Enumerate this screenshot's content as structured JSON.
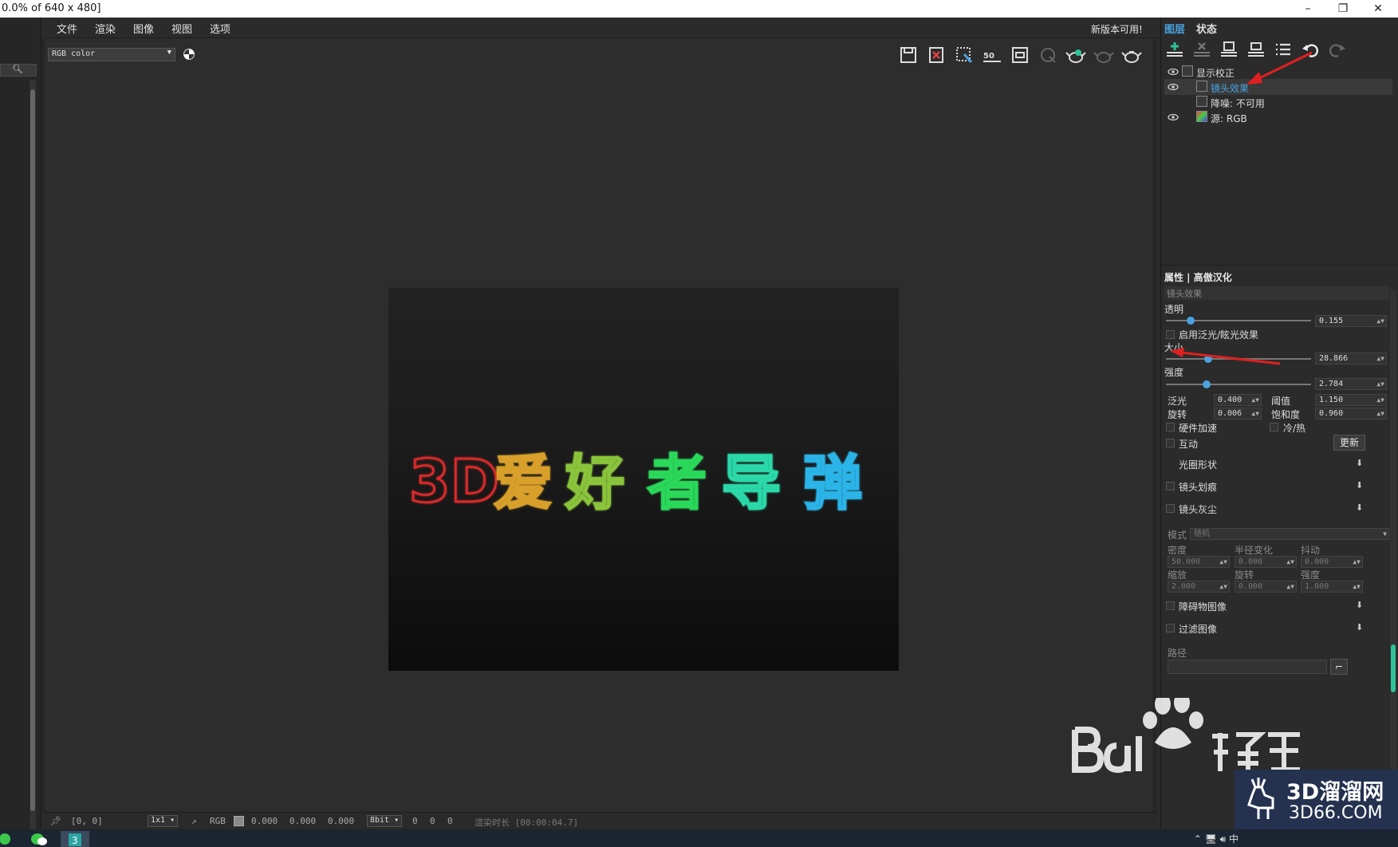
{
  "window": {
    "title": "0.0% of 640 x 480]",
    "minimize_icon": "minimize-icon",
    "restore_icon": "restore-icon",
    "close_icon": "close-icon"
  },
  "menu": {
    "items": [
      "文件",
      "渲染",
      "图像",
      "视图",
      "选项"
    ],
    "update_notice": "新版本可用!"
  },
  "toolbar": {
    "channel_select": "RGB color",
    "tool_icons": [
      "save-icon",
      "clear-icon",
      "region-select-icon",
      "zoom-50-icon",
      "frame-icon",
      "cursor-icon",
      "teapot-render-icon",
      "teapot-region-icon",
      "teapot-icon"
    ],
    "zoom_label": "50"
  },
  "render": {
    "text_chars": [
      "3D",
      "爱",
      "好",
      "者",
      "导",
      "弹"
    ],
    "colors": {
      "red": "#e02a2a",
      "orange": "#d8a02a",
      "yellow_green": "#8ac43a",
      "green": "#2ad85a",
      "teal": "#2ad8a8",
      "blue": "#2ab4e8"
    }
  },
  "status": {
    "coords": "[0, 0]",
    "ratio": "1x1",
    "channel": "RGB",
    "values": [
      "0.000",
      "0.000",
      "0.000"
    ],
    "bit_depth": "8bit",
    "ints": [
      "0",
      "0",
      "0"
    ],
    "render_time": "渲染时长 [00:00:04.7]"
  },
  "layers_panel": {
    "tabs": [
      "图层",
      "状态"
    ],
    "layers": [
      {
        "name": "显示校正",
        "visible": true,
        "selected": false
      },
      {
        "name": "镜头效果",
        "visible": true,
        "selected": true
      },
      {
        "name": "降噪: 不可用",
        "visible": false,
        "selected": false
      },
      {
        "name": "源: RGB",
        "visible": true,
        "selected": false
      }
    ]
  },
  "properties": {
    "header": "属性 | 高傲汉化",
    "section": "镜头效果",
    "opacity_label": "透明",
    "opacity_value": "0.155",
    "opacity_fraction": 0.17,
    "enable_label": "启用泛光/眩光效果",
    "size_label": "大小",
    "size_value": "28.866",
    "size_fraction": 0.29,
    "intensity_label": "强度",
    "intensity_value": "2.784",
    "intensity_fraction": 0.28,
    "bloom_label": "泛光",
    "bloom_value": "0.400",
    "threshold_label": "阈值",
    "threshold_value": "1.150",
    "rotation_label": "旋转",
    "rotation_value": "0.006",
    "saturation_label": "饱和度",
    "saturation_value": "0.960",
    "hw_accel_label": "硬件加速",
    "cold_hot_label": "冷/热",
    "interactive_label": "互动",
    "update_button": "更新",
    "aperture_label": "光圈形状",
    "scratches_label": "镜头划痕",
    "dust_label": "镜头灰尘",
    "mode_label": "模式",
    "mode_value": "随机",
    "density_label": "密度",
    "density_value": "50.000",
    "radius_var_label": "半径变化",
    "radius_var_value": "0.000",
    "jitter_label": "抖动",
    "jitter_value": "0.000",
    "scale_label": "缩放",
    "scale_value": "2.000",
    "rot2_label": "旋转",
    "rot2_value": "0.000",
    "strength_label": "强度",
    "strength_value": "1.000",
    "obstacle_label": "障碍物图像",
    "filter_label": "过滤图像",
    "path_label": "路径"
  },
  "overlay": {
    "brand_cn": "3D溜溜网",
    "brand_en": "3D66.COM"
  }
}
